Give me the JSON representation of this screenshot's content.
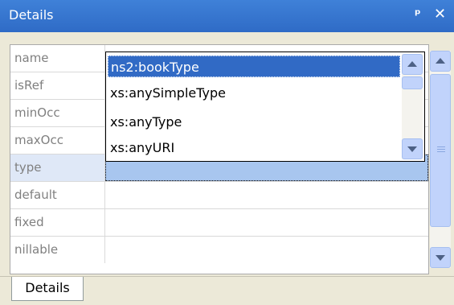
{
  "window": {
    "title": "Details",
    "pin_icon": "ᵖ",
    "close_icon": "✕"
  },
  "properties": [
    {
      "name": "name",
      "value": ""
    },
    {
      "name": "isRef",
      "value": ""
    },
    {
      "name": "minOcc",
      "value": ""
    },
    {
      "name": "maxOcc",
      "value": ""
    },
    {
      "name": "type",
      "value": ""
    },
    {
      "name": "default",
      "value": ""
    },
    {
      "name": "fixed",
      "value": ""
    },
    {
      "name": "nillable",
      "value": ""
    }
  ],
  "selected_property": "type",
  "dropdown": {
    "options": [
      "ns2:bookType",
      "xs:anySimpleType",
      "xs:anyType",
      "xs:anyURI"
    ],
    "highlighted": "ns2:bookType"
  },
  "tabs": [
    {
      "label": "Details",
      "active": true
    }
  ],
  "colors": {
    "titlebar": "#2f6bc6",
    "selection": "#316ac5",
    "selected_row": "#a8c6ef"
  },
  "icons": {
    "pin": "pin-icon",
    "close": "close-icon",
    "dropdown": "dropdown-arrow-icon"
  }
}
